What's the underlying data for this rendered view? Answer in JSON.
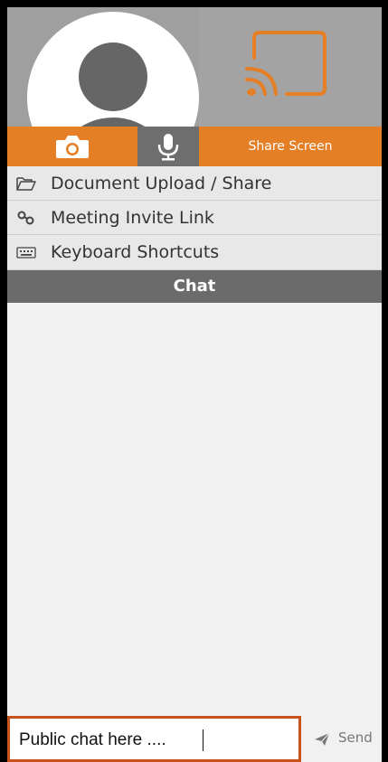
{
  "controls": {
    "camera_icon": "camera-icon",
    "mic_icon": "microphone-icon",
    "share_screen_label": "Share Screen"
  },
  "menu": [
    {
      "icon": "folder-open-icon",
      "label": "Document Upload / Share"
    },
    {
      "icon": "link-icon",
      "label": "Meeting Invite Link"
    },
    {
      "icon": "keyboard-icon",
      "label": "Keyboard Shortcuts"
    }
  ],
  "chat": {
    "title": "Chat",
    "input_placeholder": "Public chat here ....",
    "input_value": "",
    "send_label": "Send"
  },
  "colors": {
    "accent": "#e57f26",
    "header": "#6b6b6b",
    "input_border": "#c8521b"
  }
}
